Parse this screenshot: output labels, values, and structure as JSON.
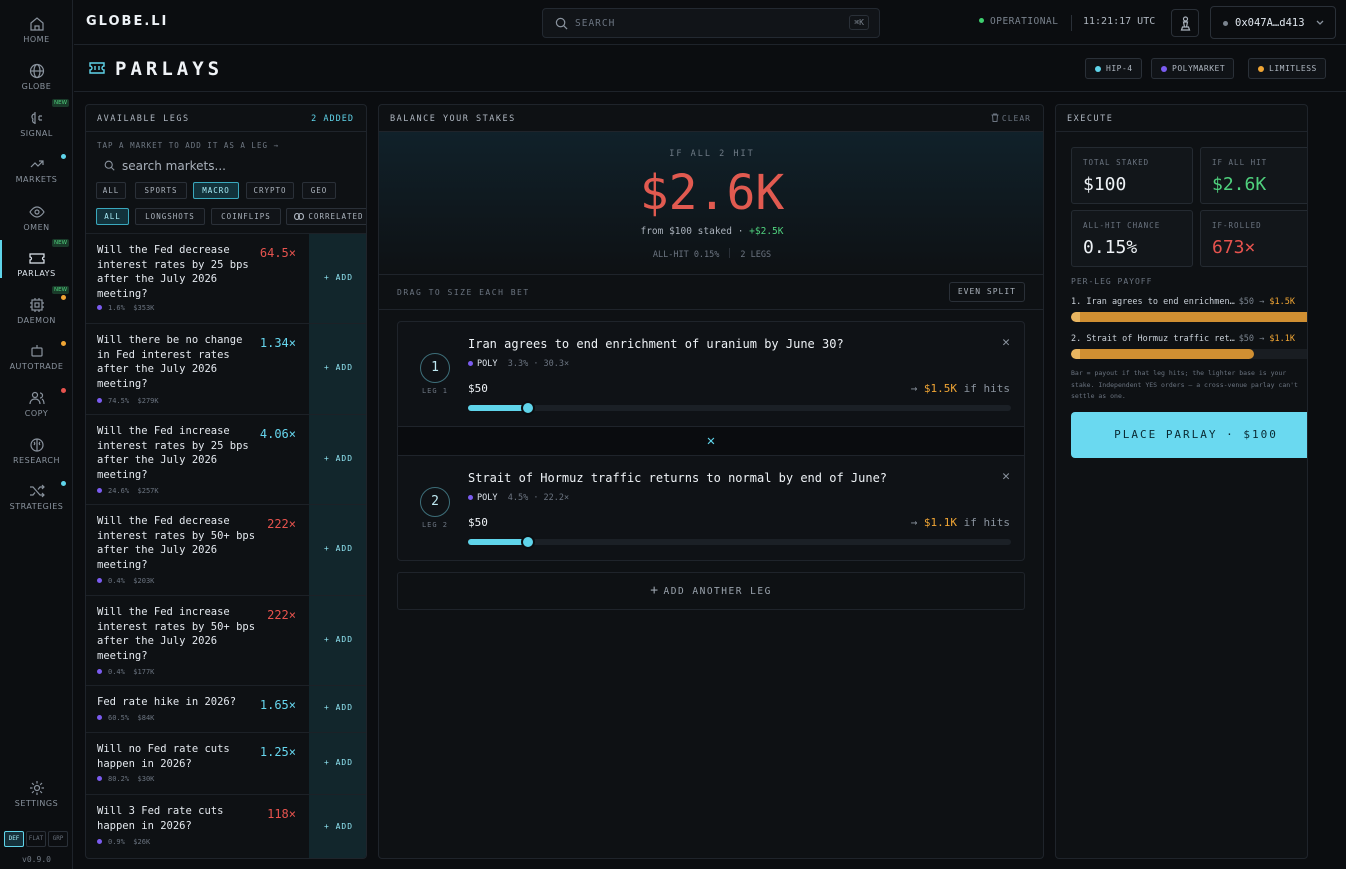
{
  "app": {
    "logo": "GLOBE.LI",
    "version": "v0.9.0"
  },
  "sidebar": {
    "items": [
      {
        "label": "HOME"
      },
      {
        "label": "GLOBE"
      },
      {
        "label": "SIGNAL",
        "badge": "NEW"
      },
      {
        "label": "MARKETS"
      },
      {
        "label": "OMEN"
      },
      {
        "label": "PARLAYS",
        "badge": "NEW"
      },
      {
        "label": "DAEMON",
        "badge": "NEW"
      },
      {
        "label": "AUTOTRADE"
      },
      {
        "label": "COPY"
      },
      {
        "label": "RESEARCH"
      },
      {
        "label": "STRATEGIES"
      },
      {
        "label": "SETTINGS"
      }
    ],
    "themes": [
      "DEF",
      "FLAT",
      "GRP"
    ]
  },
  "topbar": {
    "search_placeholder": "SEARCH",
    "search_shortcut": "⌘K",
    "status": "OPERATIONAL",
    "clock": "11:21:17 UTC",
    "wallet": "0x047A…d413"
  },
  "page": {
    "title": "PARLAYS",
    "venues": [
      {
        "label": "HIP-4",
        "color": "#5fd4ea"
      },
      {
        "label": "POLYMARKET",
        "color": "#7b5cf0"
      },
      {
        "label": "LIMITLESS",
        "color": "#f0a534"
      }
    ]
  },
  "legs_panel": {
    "title": "AVAILABLE LEGS",
    "added": "2 ADDED",
    "hint": "TAP A MARKET TO ADD IT AS A LEG →",
    "search_placeholder": "search markets...",
    "category_chips": [
      "ALL",
      "SPORTS",
      "MACRO",
      "CRYPTO",
      "GEO"
    ],
    "filter_chips": [
      "ALL",
      "LONGSHOTS",
      "COINFLIPS",
      "CORRELATED"
    ],
    "add_label": "+ ADD",
    "markets": [
      {
        "q": "Will the Fed decrease interest rates by 25 bps after the July 2026 meeting?",
        "mult": "64.5×",
        "tone": "red",
        "prob": "1.6%",
        "vol": "$353K"
      },
      {
        "q": "Will there be no change in Fed interest rates after the July 2026 meeting?",
        "mult": "1.34×",
        "tone": "cyan",
        "prob": "74.5%",
        "vol": "$279K"
      },
      {
        "q": "Will the Fed increase interest rates by 25 bps after the July 2026 meeting?",
        "mult": "4.06×",
        "tone": "cyan",
        "prob": "24.6%",
        "vol": "$257K"
      },
      {
        "q": "Will the Fed decrease interest rates by 50+ bps after the July 2026 meeting?",
        "mult": "222×",
        "tone": "red",
        "prob": "0.4%",
        "vol": "$203K"
      },
      {
        "q": "Will the Fed increase interest rates by 50+ bps after the July 2026 meeting?",
        "mult": "222×",
        "tone": "red",
        "prob": "0.4%",
        "vol": "$177K"
      },
      {
        "q": "Fed rate hike in 2026?",
        "mult": "1.65×",
        "tone": "cyan",
        "prob": "60.5%",
        "vol": "$84K"
      },
      {
        "q": "Will no Fed rate cuts happen in 2026?",
        "mult": "1.25×",
        "tone": "cyan",
        "prob": "80.2%",
        "vol": "$30K"
      },
      {
        "q": "Will 3 Fed rate cuts happen in 2026?",
        "mult": "118×",
        "tone": "red",
        "prob": "0.9%",
        "vol": "$26K"
      }
    ]
  },
  "stakes_panel": {
    "title": "BALANCE YOUR STAKES",
    "clear": "CLEAR",
    "hero_caption": "IF ALL 2 HIT",
    "hero_value": "$2.6K",
    "hero_from": "from $100 staked ·",
    "hero_gain": "+$2.5K",
    "hero_allhit": "ALL-HIT 0.15%",
    "hero_legs": "2 LEGS",
    "drag_label": "DRAG TO SIZE EACH BET",
    "even_split": "EVEN SPLIT",
    "add_leg": "ADD ANOTHER LEG",
    "legs": [
      {
        "num": "1",
        "tag": "LEG 1",
        "q": "Iran agrees to end enrichment of uranium by June 30?",
        "venue": "POLY",
        "odds": "3.3% · 30.3×",
        "stake": "$50",
        "payout": "$1.5K",
        "hits": "if hits",
        "slider": 0.11
      },
      {
        "num": "2",
        "tag": "LEG 2",
        "q": "Strait of Hormuz traffic returns to normal by end of June?",
        "venue": "POLY",
        "odds": "4.5% · 22.2×",
        "stake": "$50",
        "payout": "$1.1K",
        "hits": "if hits",
        "slider": 0.11
      }
    ]
  },
  "execute_panel": {
    "title": "EXECUTE",
    "stats": [
      {
        "label": "TOTAL STAKED",
        "value": "$100",
        "color": "#eef2f6"
      },
      {
        "label": "IF ALL HIT",
        "value": "$2.6K",
        "color": "#4fd07d"
      },
      {
        "label": "ALL-HIT CHANCE",
        "value": "0.15%",
        "color": "#eef2f6"
      },
      {
        "label": "IF-ROLLED",
        "value": "673×",
        "color": "#e6534e"
      }
    ],
    "per_leg_title": "PER-LEG PAYOFF",
    "per_leg": [
      {
        "name": "1. Iran agrees to end enrichmen…",
        "stake": "$50 →",
        "payout": "$1.5K",
        "fill": 1.0
      },
      {
        "name": "2. Strait of Hormuz traffic ret…",
        "stake": "$50 →",
        "payout": "$1.1K",
        "fill": 0.73
      }
    ],
    "note": "Bar = payout if that leg hits; the lighter base is your stake. Independent YES orders — a cross-venue parlay can't settle as one.",
    "place_button": "PLACE PARLAY · $100"
  }
}
